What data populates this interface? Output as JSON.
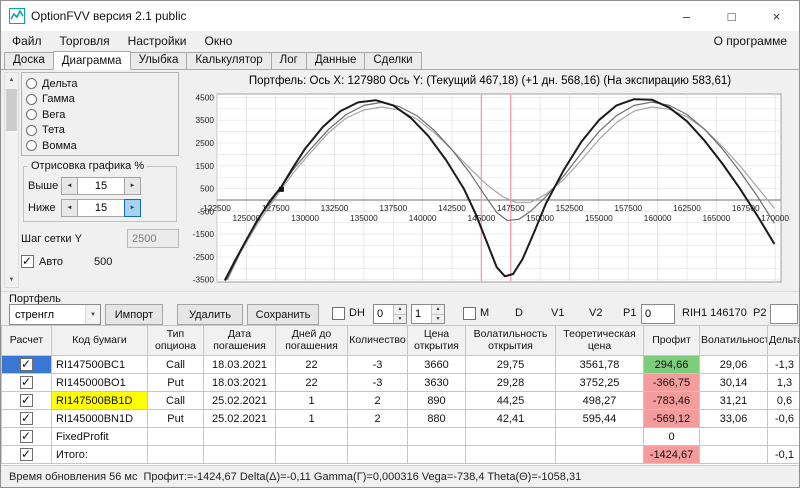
{
  "window": {
    "title": "OptionFVV версия 2.1 public",
    "controls": [
      {
        "name": "minimize-button",
        "glyph": "–"
      },
      {
        "name": "maximize-button",
        "glyph": "□"
      },
      {
        "name": "close-button",
        "glyph": "×"
      }
    ]
  },
  "icons": {
    "chevron_down": "▼",
    "arrow_left": "◄",
    "arrow_right": "►",
    "arrow_up": "▲",
    "arrow_down": "▼",
    "scroll_up": "▲",
    "scroll_down": "▼"
  },
  "menu": {
    "items": [
      "Файл",
      "Торговля",
      "Настройки",
      "Окно"
    ],
    "right": "О программе"
  },
  "tabs": {
    "items": [
      "Доска",
      "Диаграмма",
      "Улыбка",
      "Калькулятор",
      "Лог",
      "Данные",
      "Сделки"
    ],
    "active_index": 1
  },
  "sidebar": {
    "greek_options": [
      "Дельта",
      "Гамма",
      "Вега",
      "Тета",
      "Вомма"
    ],
    "draw_group": {
      "title": "Отрисовка графика %",
      "above_label": "Выше",
      "above_value": "15",
      "below_label": "Ниже",
      "below_value": "15"
    },
    "grid_step": {
      "label": "Шаг сетки Y",
      "value": "2500",
      "auto_label": "Авто",
      "auto_checked": true,
      "auto_value": "500"
    }
  },
  "chart": {
    "title": "Портфель: Ось X: 127980 Ось Y: (Текущий 467,18) (+1 дн. 568,16) (На экспирацию 583,61)",
    "chart_data": {
      "type": "line",
      "x_range": [
        122500,
        170500
      ],
      "y_range": [
        -3600,
        4650
      ],
      "grid_x_step": 2500,
      "grid_y_step": 500,
      "y_ticks": [
        4500,
        3500,
        2500,
        1500,
        500,
        -500,
        -1500,
        -2500,
        -3500
      ],
      "x_ticks_upper": [
        122500,
        127500,
        132500,
        137500,
        142500,
        147500,
        152500,
        157500,
        162500,
        167500
      ],
      "x_ticks_lower": [
        125000,
        130000,
        135000,
        140000,
        145000,
        150000,
        155000,
        160000,
        165000,
        170000
      ],
      "strike_lines": [
        145000,
        147500
      ],
      "cursor_point": {
        "x": 127980,
        "y": 467.18
      },
      "series": [
        {
          "name": "Текущий",
          "color": "#a6a6a6",
          "width": 1.2,
          "points": [
            [
              123400,
              -3500
            ],
            [
              124500,
              -2300
            ],
            [
              126000,
              -1000
            ],
            [
              127000,
              -250
            ],
            [
              127980,
              467
            ],
            [
              129000,
              1200
            ],
            [
              130500,
              2100
            ],
            [
              132000,
              2950
            ],
            [
              133500,
              3600
            ],
            [
              135000,
              3950
            ],
            [
              136500,
              4080
            ],
            [
              138000,
              3950
            ],
            [
              139500,
              3550
            ],
            [
              141000,
              2950
            ],
            [
              142500,
              2200
            ],
            [
              144000,
              1400
            ],
            [
              145500,
              650
            ],
            [
              146800,
              150
            ],
            [
              148000,
              -120
            ],
            [
              149200,
              -100
            ],
            [
              150500,
              250
            ],
            [
              152000,
              900
            ],
            [
              153500,
              1750
            ],
            [
              155000,
              2650
            ],
            [
              156500,
              3400
            ],
            [
              158000,
              3900
            ],
            [
              159500,
              4080
            ],
            [
              161000,
              3980
            ],
            [
              162500,
              3650
            ],
            [
              164000,
              3100
            ],
            [
              165500,
              2350
            ],
            [
              167000,
              1500
            ],
            [
              168500,
              550
            ],
            [
              169900,
              -350
            ]
          ]
        },
        {
          "name": "+1 дн.",
          "color": "#6e6e6e",
          "width": 1.2,
          "points": [
            [
              123300,
              -3500
            ],
            [
              124300,
              -2500
            ],
            [
              125800,
              -950
            ],
            [
              127000,
              -150
            ],
            [
              127980,
              568
            ],
            [
              129000,
              1350
            ],
            [
              130500,
              2250
            ],
            [
              132000,
              3100
            ],
            [
              133500,
              3750
            ],
            [
              135000,
              4150
            ],
            [
              136500,
              4280
            ],
            [
              138000,
              4100
            ],
            [
              139500,
              3700
            ],
            [
              141000,
              3050
            ],
            [
              142500,
              2200
            ],
            [
              144000,
              1200
            ],
            [
              145300,
              200
            ],
            [
              146300,
              -550
            ],
            [
              147200,
              -900
            ],
            [
              148200,
              -850
            ],
            [
              149300,
              -450
            ],
            [
              150500,
              150
            ],
            [
              152000,
              1050
            ],
            [
              153500,
              2050
            ],
            [
              155000,
              3000
            ],
            [
              156500,
              3700
            ],
            [
              158000,
              4150
            ],
            [
              159500,
              4300
            ],
            [
              161000,
              4150
            ],
            [
              162500,
              3750
            ],
            [
              164000,
              3100
            ],
            [
              165500,
              2250
            ],
            [
              167000,
              1250
            ],
            [
              168500,
              150
            ],
            [
              169900,
              -1000
            ]
          ]
        },
        {
          "name": "На экспирацию",
          "color": "#1b1b1b",
          "width": 2,
          "points": [
            [
              123200,
              -3500
            ],
            [
              124000,
              -2700
            ],
            [
              125000,
              -1750
            ],
            [
              126000,
              -850
            ],
            [
              127000,
              -50
            ],
            [
              127980,
              584
            ],
            [
              129000,
              1450
            ],
            [
              130000,
              2250
            ],
            [
              131500,
              3200
            ],
            [
              133000,
              3900
            ],
            [
              134500,
              4280
            ],
            [
              136000,
              4380
            ],
            [
              137500,
              4150
            ],
            [
              139000,
              3600
            ],
            [
              140500,
              2800
            ],
            [
              142000,
              1750
            ],
            [
              143500,
              500
            ],
            [
              144500,
              -600
            ],
            [
              145500,
              -1900
            ],
            [
              146300,
              -2950
            ],
            [
              147000,
              -3350
            ],
            [
              147700,
              -3250
            ],
            [
              148500,
              -2600
            ],
            [
              149500,
              -1400
            ],
            [
              150500,
              -150
            ],
            [
              152000,
              1300
            ],
            [
              153500,
              2550
            ],
            [
              155000,
              3500
            ],
            [
              156500,
              4150
            ],
            [
              158000,
              4420
            ],
            [
              159500,
              4400
            ],
            [
              161000,
              4050
            ],
            [
              162500,
              3450
            ],
            [
              164000,
              2600
            ],
            [
              165500,
              1600
            ],
            [
              167000,
              500
            ],
            [
              168500,
              -700
            ],
            [
              169900,
              -1900
            ]
          ]
        }
      ]
    }
  },
  "portfolio": {
    "section_label": "Портфель",
    "preset": "стренгл",
    "buttons": [
      "Импорт",
      "Удалить",
      "Сохранить"
    ],
    "dh_label": "DH",
    "dh_values": [
      "0",
      "1"
    ],
    "m_label": "M",
    "d_label": "D",
    "v1_label": "V1",
    "v2_label": "V2",
    "p1_label": "P1",
    "p1_value": "0",
    "underlying": "RIH1 146170",
    "p2_label": "P2"
  },
  "table": {
    "columns": [
      "Расчет",
      "Код бумаги",
      "Тип опциона",
      "Дата погашения",
      "Дней до погашения",
      "Количество",
      "Цена открытия",
      "Волатильность открытия",
      "Теоретическая цена",
      "Профит",
      "Волатильность",
      "Дельта"
    ],
    "rows": [
      {
        "checked": true,
        "selected": true,
        "code": "RI147500BC1",
        "code_highlight": false,
        "type": "Call",
        "date": "18.03.2021",
        "days": "22",
        "qty": "-3",
        "open_price": "3660",
        "open_vol": "29,75",
        "theo_price": "3561,78",
        "profit": "294,66",
        "profit_color": "green",
        "vol": "29,06",
        "delta": "-1,3"
      },
      {
        "checked": true,
        "selected": false,
        "code": "RI145000BO1",
        "code_highlight": false,
        "type": "Put",
        "date": "18.03.2021",
        "days": "22",
        "qty": "-3",
        "open_price": "3630",
        "open_vol": "29,28",
        "theo_price": "3752,25",
        "profit": "-366,75",
        "profit_color": "red",
        "vol": "30,14",
        "delta": "1,3"
      },
      {
        "checked": true,
        "selected": false,
        "code": "RI147500BB1D",
        "code_highlight": true,
        "type": "Call",
        "date": "25.02.2021",
        "days": "1",
        "qty": "2",
        "open_price": "890",
        "open_vol": "44,25",
        "theo_price": "498,27",
        "profit": "-783,46",
        "profit_color": "red",
        "vol": "31,21",
        "delta": "0,6"
      },
      {
        "checked": true,
        "selected": false,
        "code": "RI145000BN1D",
        "code_highlight": false,
        "type": "Put",
        "date": "25.02.2021",
        "days": "1",
        "qty": "2",
        "open_price": "880",
        "open_vol": "42,41",
        "theo_price": "595,44",
        "profit": "-569,12",
        "profit_color": "red",
        "vol": "33,06",
        "delta": "-0,6"
      },
      {
        "checked": true,
        "selected": false,
        "code": "FixedProfit",
        "code_highlight": false,
        "type": "",
        "date": "",
        "days": "",
        "qty": "",
        "open_price": "",
        "open_vol": "",
        "theo_price": "",
        "profit": "0",
        "profit_color": "none",
        "vol": "",
        "delta": ""
      },
      {
        "checked": true,
        "selected": false,
        "code": "Итого:",
        "code_highlight": false,
        "type": "",
        "date": "",
        "days": "",
        "qty": "",
        "open_price": "",
        "open_vol": "",
        "theo_price": "",
        "profit": "-1424,67",
        "profit_color": "red",
        "vol": "",
        "delta": "-0,1"
      }
    ]
  },
  "status_bar": {
    "time": "Время обновления 56 мс",
    "metrics": "Профит:=-1424,67 Delta(Δ)=-0,11 Gamma(Γ)=0,000316 Vega=-738,4 Theta(Θ)=-1058,31"
  }
}
